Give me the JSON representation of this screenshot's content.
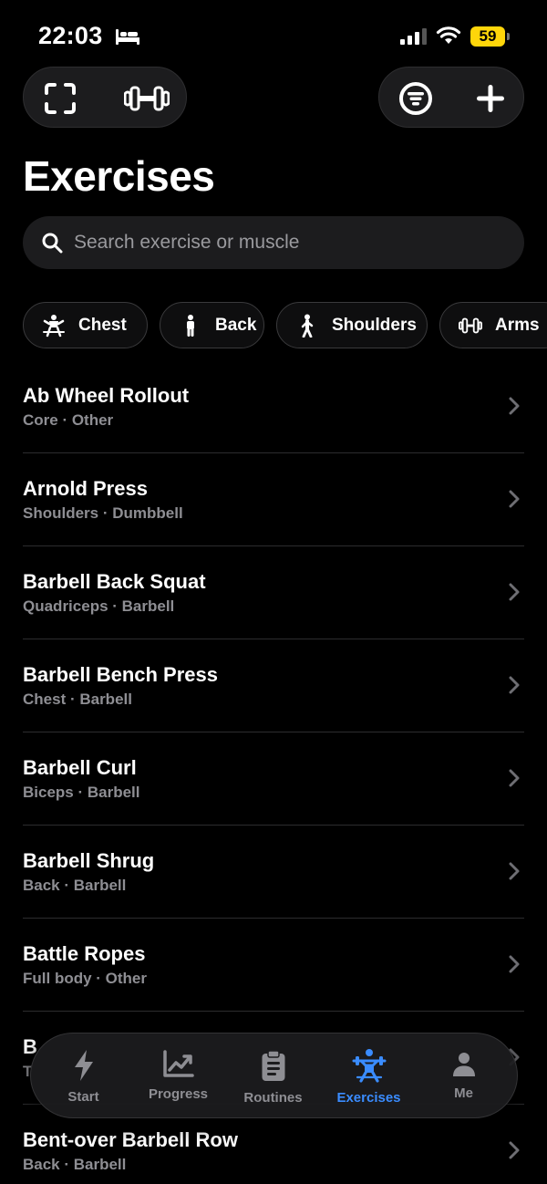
{
  "status_bar": {
    "time": "22:03",
    "battery": "59"
  },
  "header": {
    "title": "Exercises"
  },
  "search": {
    "placeholder": "Search exercise or muscle"
  },
  "chips": [
    {
      "label": "Chest",
      "icon": "chest-figure-icon"
    },
    {
      "label": "Back",
      "icon": "standing-figure-icon"
    },
    {
      "label": "Shoulders",
      "icon": "walking-figure-icon"
    },
    {
      "label": "Arms",
      "icon": "dumbbell-icon"
    }
  ],
  "exercises": [
    {
      "name": "Ab Wheel Rollout",
      "detail": "Core · Other"
    },
    {
      "name": "Arnold Press",
      "detail": "Shoulders · Dumbbell"
    },
    {
      "name": "Barbell Back Squat",
      "detail": "Quadriceps · Barbell"
    },
    {
      "name": "Barbell Bench Press",
      "detail": "Chest · Barbell"
    },
    {
      "name": "Barbell Curl",
      "detail": "Biceps · Barbell"
    },
    {
      "name": "Barbell Shrug",
      "detail": "Back · Barbell"
    },
    {
      "name": "Battle Ropes",
      "detail": "Full body · Other"
    },
    {
      "name": "B",
      "detail": "T"
    },
    {
      "name": "Bent-over Barbell Row",
      "detail": "Back · Barbell"
    }
  ],
  "tabbar": {
    "items": [
      {
        "label": "Start",
        "icon": "bolt-icon"
      },
      {
        "label": "Progress",
        "icon": "chart-icon"
      },
      {
        "label": "Routines",
        "icon": "clipboard-icon"
      },
      {
        "label": "Exercises",
        "icon": "weightlifter-icon"
      },
      {
        "label": "Me",
        "icon": "person-icon"
      }
    ],
    "active": "Exercises"
  },
  "colors": {
    "accent": "#3a8cff",
    "battery": "#ffd60a",
    "secondary_text": "#8e8e93"
  }
}
